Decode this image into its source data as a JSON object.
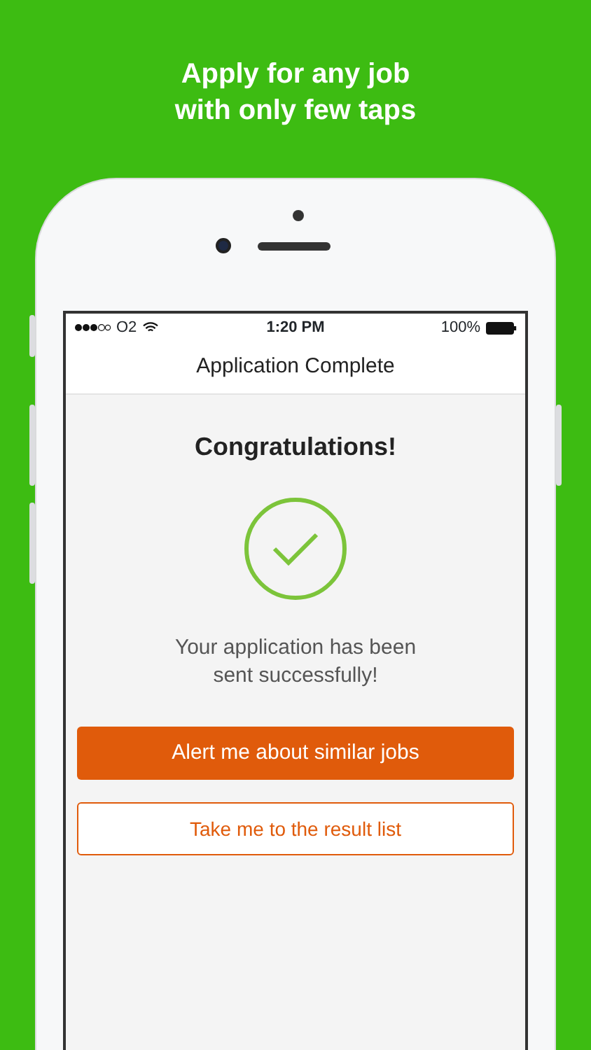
{
  "headline": {
    "lines": [
      "Apply for any job",
      "with only few taps"
    ]
  },
  "status_bar": {
    "carrier": "O2",
    "time": "1:20 PM",
    "battery": "100%"
  },
  "nav_bar": {
    "title": "Application Complete"
  },
  "content": {
    "heading": "Congratulations!",
    "message_lines": [
      "Your application has been",
      "sent successfully!"
    ],
    "buttons": [
      {
        "label": "Alert me about similar jobs",
        "kind": "primary"
      },
      {
        "label": "Take me to the result list",
        "kind": "outline"
      }
    ]
  }
}
